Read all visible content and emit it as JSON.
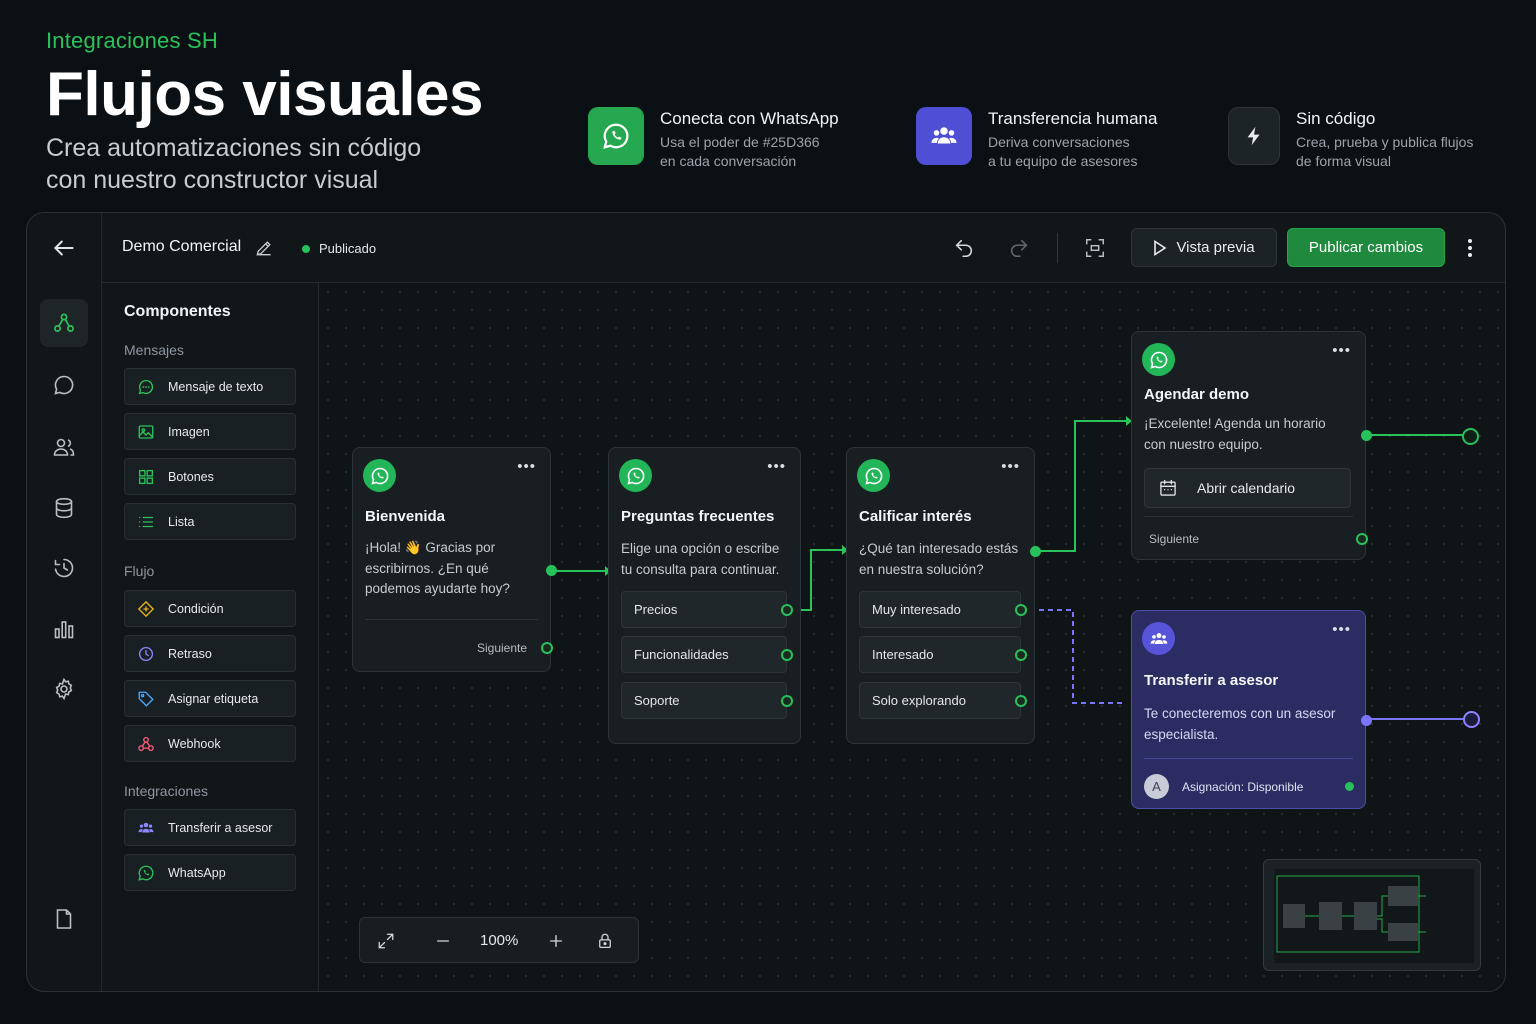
{
  "hero": {
    "brand": "Integraciones SH",
    "title": "Flujos visuales",
    "subtitle_line1": "Crea automatizaciones sin código",
    "subtitle_line2": "con nuestro constructor visual"
  },
  "features": [
    {
      "icon": "whatsapp-icon",
      "title": "Conecta con WhatsApp",
      "desc1": "Usa el poder de #25D366",
      "desc2": "en cada conversación",
      "color": "#25a84f"
    },
    {
      "icon": "users-icon",
      "title": "Transferencia humana",
      "desc1": "Deriva conversaciones",
      "desc2": "a tu equipo de asesores",
      "color": "#4f4fd6"
    },
    {
      "icon": "bolt-icon",
      "title": "Sin código",
      "desc1": "Crea, prueba y publica flujos",
      "desc2": "de forma visual",
      "color": "#1d2428"
    }
  ],
  "topbar": {
    "flow_name": "Demo Comercial",
    "status": "Publicado",
    "preview_label": "Vista previa",
    "publish_label": "Publicar cambios"
  },
  "panel": {
    "title": "Componentes",
    "sections": [
      {
        "label": "Mensajes",
        "items": [
          {
            "label": "Mensaje de texto",
            "icon": "message-icon"
          },
          {
            "label": "Imagen",
            "icon": "image-icon"
          },
          {
            "label": "Botones",
            "icon": "grid-icon"
          },
          {
            "label": "Lista",
            "icon": "list-icon"
          }
        ]
      },
      {
        "label": "Flujo",
        "items": [
          {
            "label": "Condición",
            "icon": "condition-icon"
          },
          {
            "label": "Retraso",
            "icon": "clock-icon"
          },
          {
            "label": "Asignar etiqueta",
            "icon": "tag-icon"
          },
          {
            "label": "Webhook",
            "icon": "webhook-icon"
          }
        ]
      },
      {
        "label": "Integraciones",
        "items": [
          {
            "label": "Transferir a asesor",
            "icon": "users-icon"
          },
          {
            "label": "WhatsApp",
            "icon": "whatsapp-icon"
          }
        ]
      }
    ]
  },
  "nodes": {
    "bienvenida": {
      "title": "Bienvenida",
      "body1": "¡Hola! 👋 Gracias por",
      "body2": "escribirnos. ¿En qué",
      "body3": "podemos ayudarte hoy?",
      "footer": "Siguiente"
    },
    "faq": {
      "title": "Preguntas frecuentes",
      "body1": "Elige una opción o escribe",
      "body2": "tu consulta para continuar.",
      "options": [
        "Precios",
        "Funcionalidades",
        "Soporte"
      ]
    },
    "interes": {
      "title": "Calificar interés",
      "body1": "¿Qué tan interesado estás",
      "body2": "en nuestra solución?",
      "options": [
        "Muy interesado",
        "Interesado",
        "Solo explorando"
      ]
    },
    "demo": {
      "title": "Agendar demo",
      "body1": "¡Excelente! Agenda un horario",
      "body2": "con nuestro equipo.",
      "button": "Abrir calendario",
      "footer": "Siguiente"
    },
    "asesor": {
      "title": "Transferir a asesor",
      "body1": "Te conecteremos con un asesor",
      "body2": "especialista.",
      "avatar": "A",
      "assignment": "Asignación: Disponible"
    }
  },
  "zoom": {
    "value": "100%"
  },
  "colors": {
    "accent": "#25D366",
    "publish": "#1f8a3d",
    "purple": "#7b74ff"
  }
}
